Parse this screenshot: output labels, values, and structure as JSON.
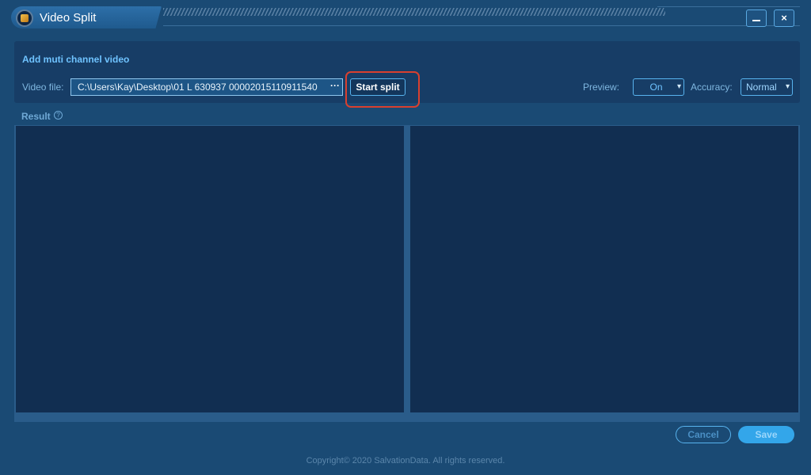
{
  "window": {
    "title": "Video Split",
    "minimize_label": "_",
    "close_label": "×"
  },
  "input_panel": {
    "heading": "Add muti channel video",
    "video_file_label": "Video file:",
    "video_file_value": "C:\\Users\\Kay\\Desktop\\01 L 630937 00002015110911540",
    "browse_label": "···",
    "start_split_label": "Start split",
    "preview_label": "Preview:",
    "preview_value": "On",
    "accuracy_label": "Accuracy:",
    "accuracy_value": "Normal"
  },
  "result": {
    "label": "Result",
    "help_glyph": "?"
  },
  "footer": {
    "cancel_label": "Cancel",
    "save_label": "Save",
    "copyright": "Copyright© 2020 SalvationData. All rights reserved."
  },
  "colors": {
    "background": "#1a4a74",
    "panel": "#173d66",
    "accent": "#58b3ee",
    "highlight": "#d9402f",
    "save_button": "#33a6ea"
  }
}
